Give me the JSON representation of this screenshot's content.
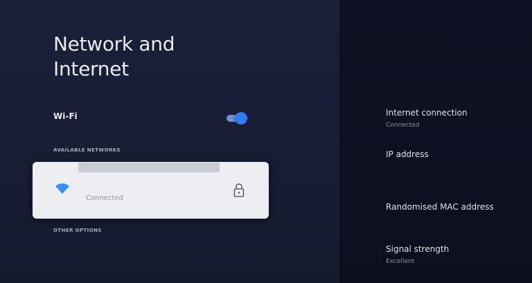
{
  "header": {
    "title": "Network and Internet"
  },
  "wifi": {
    "label": "Wi-Fi",
    "enabled": true
  },
  "available_networks": {
    "section_label": "AVAILABLE NETWORKS",
    "items": [
      {
        "status": "Connected",
        "icon": "wifi-icon",
        "secured_icon": "lock-icon"
      }
    ]
  },
  "other_options": {
    "section_label": "OTHER OPTIONS"
  },
  "details": {
    "internet_connection": {
      "title": "Internet connection",
      "value": "Connected"
    },
    "ip_address": {
      "title": "IP address"
    },
    "mac_address": {
      "title": "Randomised MAC address"
    },
    "signal_strength": {
      "title": "Signal strength",
      "value": "Excellent"
    }
  },
  "colors": {
    "accent": "#2f7bf0",
    "card_background": "#eceef2",
    "text_primary": "#e9ebf0"
  }
}
